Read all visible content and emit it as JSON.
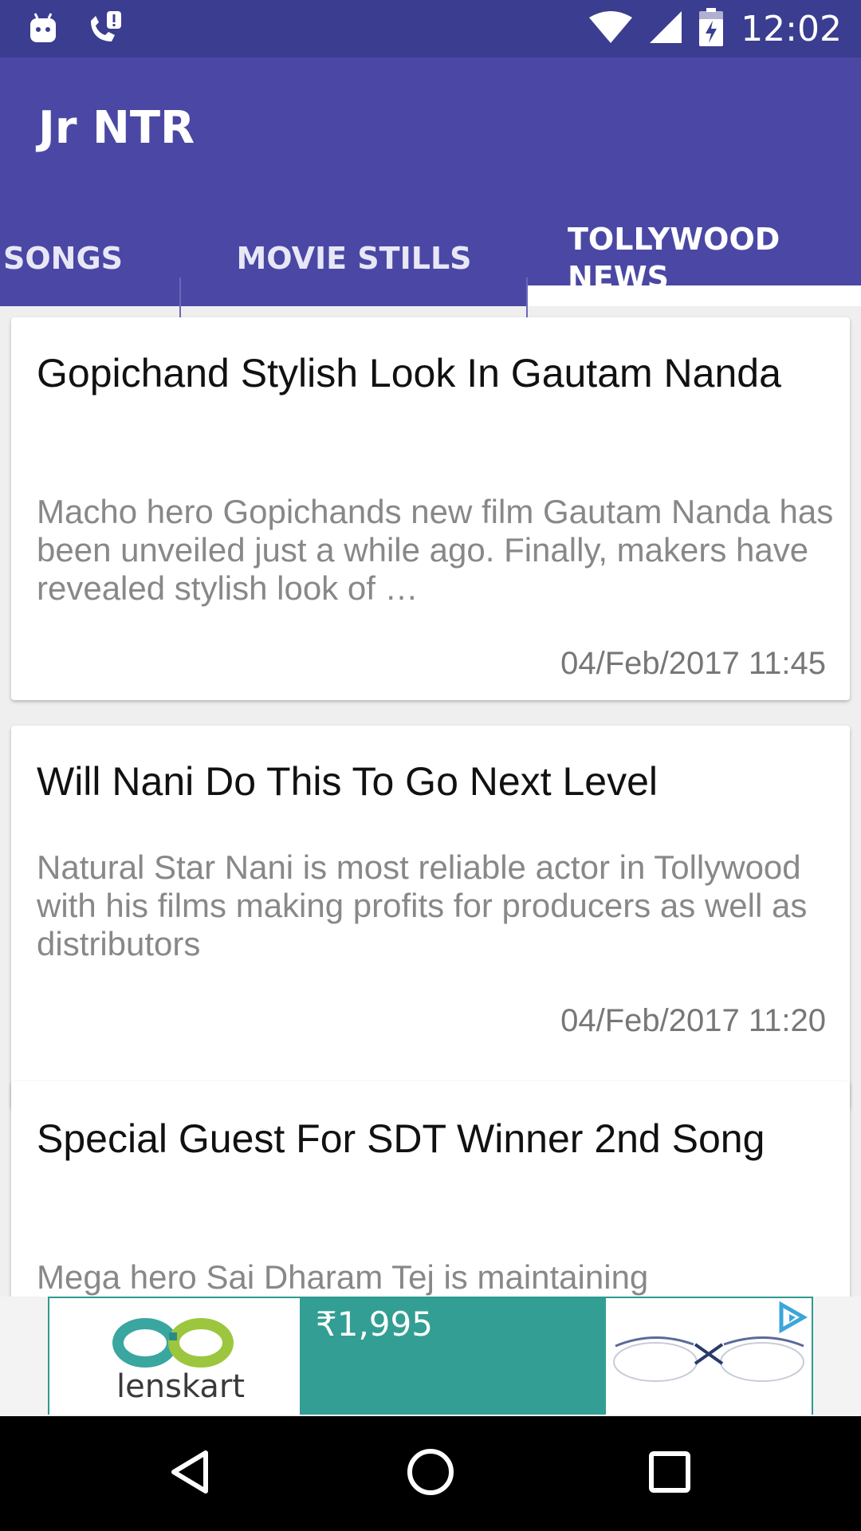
{
  "status_bar": {
    "time": "12:02",
    "left_icons": [
      "android-debug-icon",
      "missed-call-icon"
    ],
    "right_icons": [
      "wifi-icon",
      "signal-icon",
      "battery-charging-icon"
    ]
  },
  "app_bar": {
    "title": "Jr NTR",
    "color": "#4a48a4",
    "status_color": "#3b3d90"
  },
  "tabs": [
    {
      "label": "SONGS",
      "selected": false
    },
    {
      "label": "MOVIE STILLS",
      "selected": false
    },
    {
      "label": "TOLLYWOOD NEWS",
      "label_line1": "TOLLYWOOD",
      "label_line2": "NEWS",
      "selected": true
    }
  ],
  "news": [
    {
      "title": "Gopichand Stylish Look In Gautam Nanda",
      "description": "Macho hero Gopichands new film Gautam Nanda has been unveiled just a while ago. Finally, makers have revealed stylish look of …",
      "date": "04/Feb/2017 11:45"
    },
    {
      "title": "Will Nani Do This To Go Next Level",
      "description": "Natural Star Nani is most reliable actor in Tollywood with his films making profits for producers as well as distributors",
      "date": "04/Feb/2017 11:20"
    },
    {
      "title": "Special Guest For SDT Winner 2nd Song",
      "description": "Mega hero Sai Dharam Tej is maintaining",
      "date": ""
    }
  ],
  "ad": {
    "brand": "lenskart",
    "price": "₹1,995",
    "accent": "#339e93"
  },
  "nav_bar": {
    "buttons": [
      "back-icon",
      "home-icon",
      "recents-icon"
    ]
  }
}
